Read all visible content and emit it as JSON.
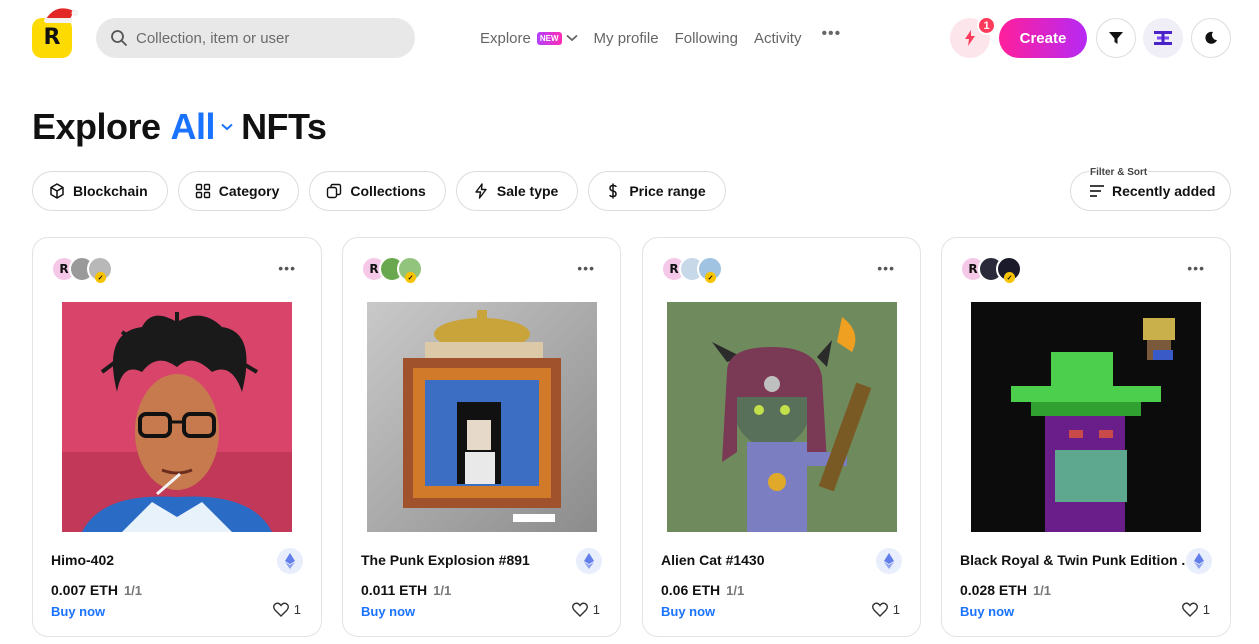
{
  "header": {
    "logo_letter": "R",
    "search_placeholder": "Collection, item or user",
    "nav": {
      "explore": "Explore",
      "explore_badge": "NEW",
      "my_profile": "My profile",
      "following": "Following",
      "activity": "Activity",
      "more": "•••"
    },
    "notification_count": "1",
    "create_label": "Create"
  },
  "page": {
    "title_prefix": "Explore",
    "title_filter": "All",
    "title_suffix": "NFTs"
  },
  "filters": [
    {
      "label": "Blockchain",
      "icon": "cube-icon"
    },
    {
      "label": "Category",
      "icon": "grid-icon"
    },
    {
      "label": "Collections",
      "icon": "collections-icon"
    },
    {
      "label": "Sale type",
      "icon": "bolt-icon"
    },
    {
      "label": "Price range",
      "icon": "dollar-icon"
    }
  ],
  "sort": {
    "label": "Filter & Sort",
    "value": "Recently added"
  },
  "cards": [
    {
      "name": "Himo-402",
      "price": "0.007 ETH",
      "edition": "1/1",
      "buy_label": "Buy now",
      "likes": "1"
    },
    {
      "name": "The Punk Explosion #891",
      "price": "0.011 ETH",
      "edition": "1/1",
      "buy_label": "Buy now",
      "likes": "1"
    },
    {
      "name": "Alien Cat #1430",
      "price": "0.06 ETH",
      "edition": "1/1",
      "buy_label": "Buy now",
      "likes": "1"
    },
    {
      "name": "Black Royal & Twin Punk Edition ...",
      "price": "0.028 ETH",
      "edition": "1/1",
      "buy_label": "Buy now",
      "likes": "1"
    }
  ],
  "colors": {
    "accent_blue": "#1a73ff",
    "create_gradient_start": "#ff1f9a",
    "create_gradient_end": "#b629f5",
    "logo_yellow": "#FEDA03"
  }
}
